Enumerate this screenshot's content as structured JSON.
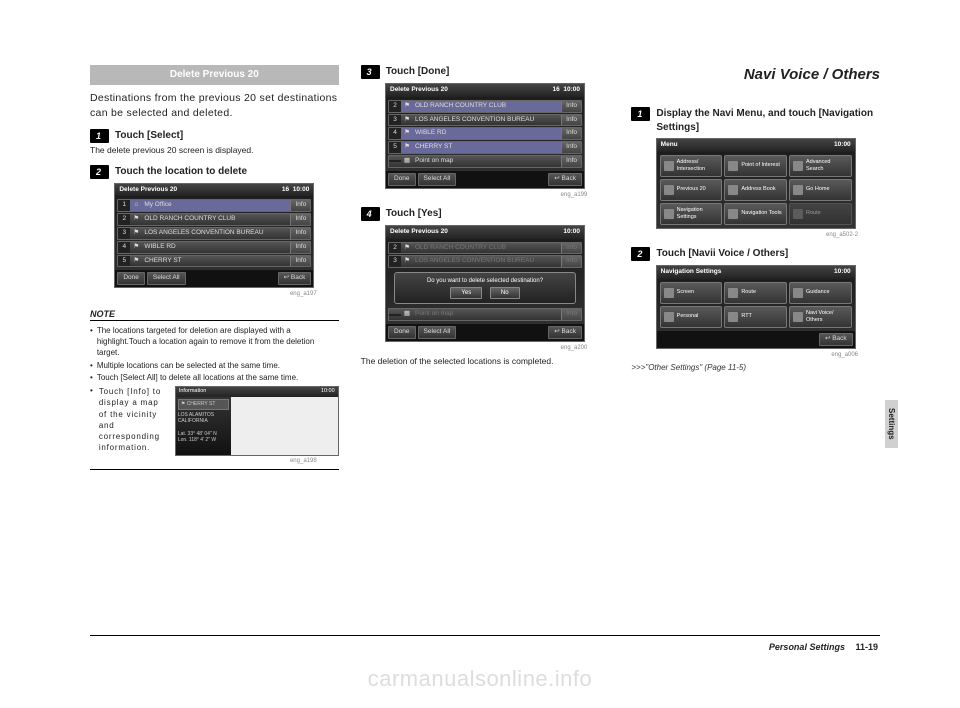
{
  "watermark": "carmanualsonline.info",
  "side_tab": "Settings",
  "footer": {
    "section": "Personal Settings",
    "page": "11-19"
  },
  "col1": {
    "header": "Delete Previous 20",
    "intro": "Destinations from the previous 20 set destinations can be selected and deleted.",
    "step1": {
      "num": "1",
      "label": "Touch [Select]"
    },
    "sub1": "The delete previous 20 screen is displayed.",
    "step2": {
      "num": "2",
      "label": "Touch the location to delete"
    },
    "screenA": {
      "title": "Delete Previous 20",
      "count": "16",
      "time": "10:00",
      "rows": [
        {
          "idx": "1",
          "label": "My Office",
          "info": "Info"
        },
        {
          "idx": "2",
          "label": "OLD RANCH COUNTRY CLUB",
          "info": "Info"
        },
        {
          "idx": "3",
          "label": "LOS ANGELES CONVENTION BUREAU",
          "info": "Info"
        },
        {
          "idx": "4",
          "label": "WIBLE RD",
          "info": "Info"
        },
        {
          "idx": "5",
          "label": "CHERRY ST",
          "info": "Info"
        }
      ],
      "footer": {
        "done": "Done",
        "select_all": "Select All",
        "back": "Back"
      },
      "caption": "eng_a197"
    },
    "note_head": "NOTE",
    "bullets": [
      "The locations targeted for deletion are displayed with a highlight.Touch a location again to remove it from the deletion target.",
      "Multiple locations can be selected at the same time.",
      "Touch [Select All] to delete all locations at the same time."
    ],
    "note4_text": "Touch [Info] to display a map of the vicinity and corresponding information.",
    "info_screen": {
      "title": "Information",
      "time": "10:00",
      "place": "CHERRY ST",
      "addr1": "LOS ALAMITOS",
      "addr2": "CALIFORNIA",
      "lat": "Lat.   33° 48' 04\" N",
      "lon": "Lon. 118°  4'  2\" W",
      "caption": "eng_a198"
    }
  },
  "col2": {
    "step3": {
      "num": "3",
      "label": "Touch [Done]"
    },
    "screenB": {
      "title": "Delete Previous 20",
      "count": "16",
      "time": "10:00",
      "rows": [
        {
          "idx": "2",
          "label": "OLD RANCH COUNTRY CLUB",
          "info": "Info"
        },
        {
          "idx": "3",
          "label": "LOS ANGELES CONVENTION BUREAU",
          "info": "Info"
        },
        {
          "idx": "4",
          "label": "WIBLE RD",
          "info": "Info"
        },
        {
          "idx": "5",
          "label": "CHERRY ST",
          "info": "Info"
        },
        {
          "idx": "",
          "label": "Point on map",
          "info": "Info"
        }
      ],
      "footer": {
        "done": "Done",
        "select_all": "Select All",
        "back": "Back"
      },
      "caption": "eng_a199"
    },
    "step4": {
      "num": "4",
      "label": "Touch [Yes]"
    },
    "screenC": {
      "title": "Delete Previous 20",
      "time": "10:00",
      "rows": [
        {
          "idx": "2",
          "label": "OLD RANCH COUNTRY CLUB",
          "info": "Info"
        },
        {
          "idx": "3",
          "label": "LOS ANGELES CONVENTION BUREAU",
          "info": "Info"
        }
      ],
      "dialog": {
        "msg": "Do you want to delete selected destination?",
        "yes": "Yes",
        "no": "No"
      },
      "rows2": [
        {
          "idx": "",
          "label": "Point on map",
          "info": "Info"
        }
      ],
      "footer": {
        "done": "Done",
        "select_all": "Select All",
        "back": "Back"
      },
      "caption": "eng_a200"
    },
    "result": "The deletion of the selected locations is completed."
  },
  "col3": {
    "title": "Navi Voice / Others",
    "step1": {
      "num": "1",
      "label": "Display the Navi Menu, and touch [Navigation Settings]"
    },
    "menu_screen": {
      "title": "Menu",
      "time": "10:00",
      "cells": [
        "Address/\nIntersection",
        "Point of\nInterest",
        "Advanced\nSearch",
        "Previous\n20",
        "Address\nBook",
        "Go Home",
        "Navigation\nSettings",
        "Navigation\nTools",
        "Route"
      ],
      "caption": "eng_a502-2"
    },
    "step2": {
      "num": "2",
      "label": "Touch [Navii Voice / Others]"
    },
    "nav_settings_screen": {
      "title": "Navigation Settings",
      "time": "10:00",
      "cells": [
        "Screen",
        "Route",
        "Guidance",
        "Personal",
        "RTT",
        "Navi Voice/\nOthers"
      ],
      "back": "Back",
      "caption": "eng_a006"
    },
    "cross_ref": ">>>\"Other Settings\" (Page 11-5)"
  }
}
